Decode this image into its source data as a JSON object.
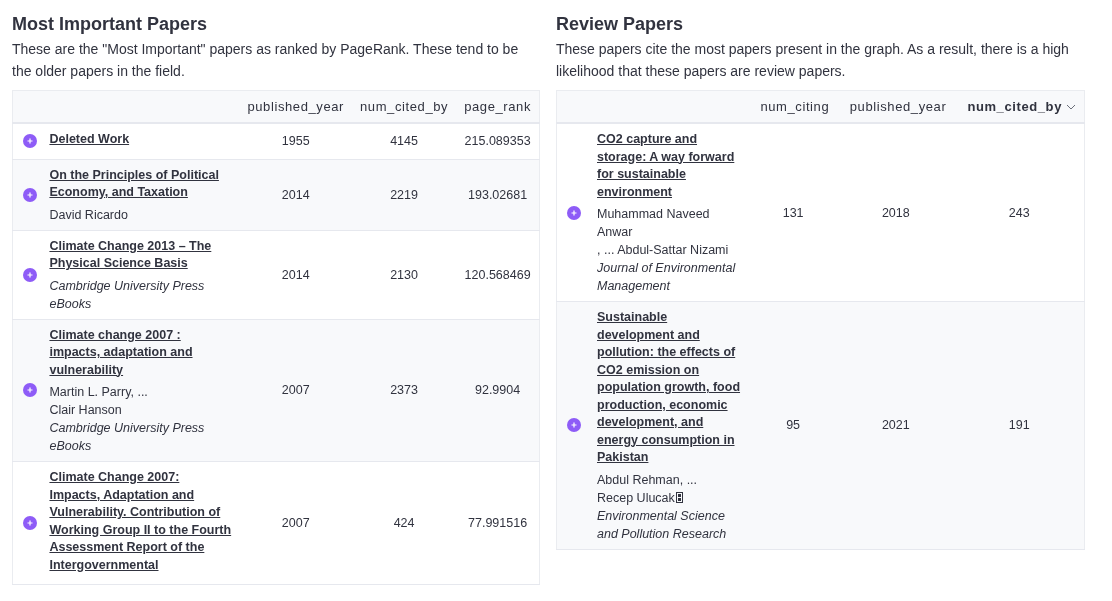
{
  "sections": [
    {
      "title": "Most Important Papers",
      "description": "These are the \"Most Important\" papers as ranked by PageRank. These tend to be the older papers in the field.",
      "columns": [
        {
          "label": "published_year",
          "sorted": false
        },
        {
          "label": "num_cited_by",
          "sorted": false
        },
        {
          "label": "page_rank",
          "sorted": false
        }
      ],
      "rows": [
        {
          "title": "Deleted Work",
          "authors": [],
          "venue": "",
          "values": [
            "1955",
            "4145",
            "215.089353"
          ]
        },
        {
          "title": "On the Principles of Political Economy, and Taxation",
          "authors": [
            "David Ricardo"
          ],
          "values": [
            "2014",
            "2219",
            "193.02681"
          ]
        },
        {
          "title": "Climate Change 2013 – The Physical Science Basis",
          "authors": [],
          "venue": "Cambridge University Press eBooks",
          "values": [
            "2014",
            "2130",
            "120.568469"
          ]
        },
        {
          "title": "Climate change 2007 : impacts, adaptation and vulnerability",
          "authors": [
            "Martin L. Parry, ...",
            "Clair Hanson"
          ],
          "venue": "Cambridge University Press eBooks",
          "values": [
            "2007",
            "2373",
            "92.9904"
          ]
        },
        {
          "title": "Climate Change 2007: Impacts, Adaptation and Vulnerability. Contribution of Working Group II to the Fourth Assessment Report of the Intergovernmental",
          "authors": [],
          "values": [
            "2007",
            "424",
            "77.991516"
          ]
        }
      ]
    },
    {
      "title": "Review Papers",
      "description": "These papers cite the most papers present in the graph. As a result, there is a high likelihood that these papers are review papers.",
      "columns": [
        {
          "label": "num_citing",
          "sorted": false
        },
        {
          "label": "published_year",
          "sorted": false
        },
        {
          "label": "num_cited_by",
          "sorted": true
        }
      ],
      "rows": [
        {
          "title": "CO2 capture and storage: A way forward for sustainable environment",
          "authors": [
            "Muhammad Naveed Anwar",
            ", ... Abdul-Sattar Nizami"
          ],
          "venue": "Journal of Environmental Management",
          "values": [
            "131",
            "2018",
            "243"
          ]
        },
        {
          "title": "Sustainable development and pollution: the effects of CO2 emission on population growth, food production, economic development, and energy consumption in Pakistan",
          "authors": [
            "Abdul Rehman, ...",
            "Recep Ulucak"
          ],
          "venue": "Environmental Science and Pollution Research",
          "values": [
            "95",
            "2021",
            "191"
          ]
        }
      ]
    }
  ]
}
